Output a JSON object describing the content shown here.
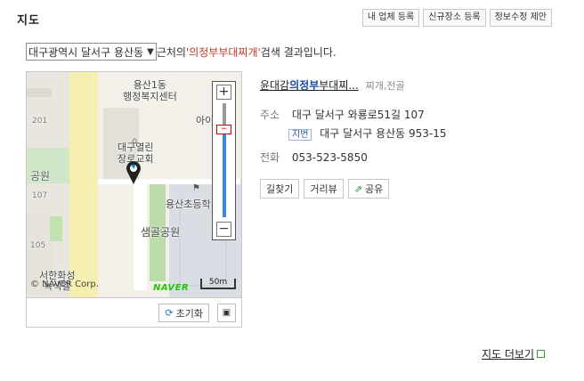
{
  "header": {
    "title": "지도"
  },
  "top_buttons": [
    "내 업체 등록",
    "신규장소 등록",
    "정보수정 제안"
  ],
  "search": {
    "region": "대구광역시 달서구 용산동",
    "prefix": " 근처의 ",
    "keyword": "'의정부부대찌개'",
    "suffix": " 검색 결과입니다."
  },
  "map": {
    "labels": {
      "center": "용산1동\n행정복지센터",
      "church": "대구열린\n장로교회",
      "park_left": "공원",
      "n201": "201",
      "n107": "107",
      "n105": "105",
      "ai": "아이",
      "school": "용산초등학",
      "saemgol": "샘골공원",
      "seohan": "서한화성\n녹색길"
    },
    "copyright": "© NAVER Corp.",
    "brand": "NAVER",
    "scale": "50m",
    "zoom_in": "+",
    "zoom_out": "−"
  },
  "map_footer": {
    "reset": "초기화"
  },
  "place": {
    "name_plain": "윤대감",
    "name_bold": "의정부",
    "name_rest": "부대찌...",
    "category": "찌개,전골",
    "address_label": "주소",
    "address": "대구 달서구 와룡로51길 107",
    "jibun_label": "지번",
    "jibun": "대구 달서구 용산동 953-15",
    "phone_label": "전화",
    "phone": "053-523-5850"
  },
  "actions": {
    "route": "길찾기",
    "roadview": "거리뷰",
    "share": "공유"
  },
  "more": {
    "label": "지도 더보기"
  },
  "colors": {
    "keyword": "#c0392b",
    "zoom": "#3a8ad6",
    "naver": "#1ec800"
  }
}
